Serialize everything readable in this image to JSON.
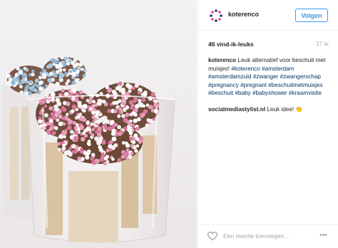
{
  "post": {
    "username": "koterenco",
    "follow_label": "Volgen",
    "likes": "46 vind-ik-leuks",
    "age": "17 w.",
    "caption_user": "koterenco",
    "caption_text": "Leuk alternatief voor beschuit met muisjes!",
    "hashtags": [
      "#koterenco",
      "#amsterdam",
      "#amsterdamzuid",
      "#zwanger",
      "#zwangerschap",
      "#pregnancy",
      "#pregnant",
      "#beschuitmetmuisjes",
      "#beschuit",
      "#baby",
      "#babyshower",
      "#kraamvisite"
    ],
    "comment_user": "socialmediastylist.nl",
    "comment_text": "Leuk idee! 👏",
    "reply_placeholder": "Een reactie toevoegen...",
    "more_label": "•••"
  },
  "colors": {
    "follow_blue": "#3897f0",
    "hashtag": "#003569",
    "muted": "#a5a7aa"
  },
  "icons": {
    "logo": "koterenco-dot-logo",
    "like": "heart-outline-icon",
    "options": "ellipsis-icon"
  }
}
